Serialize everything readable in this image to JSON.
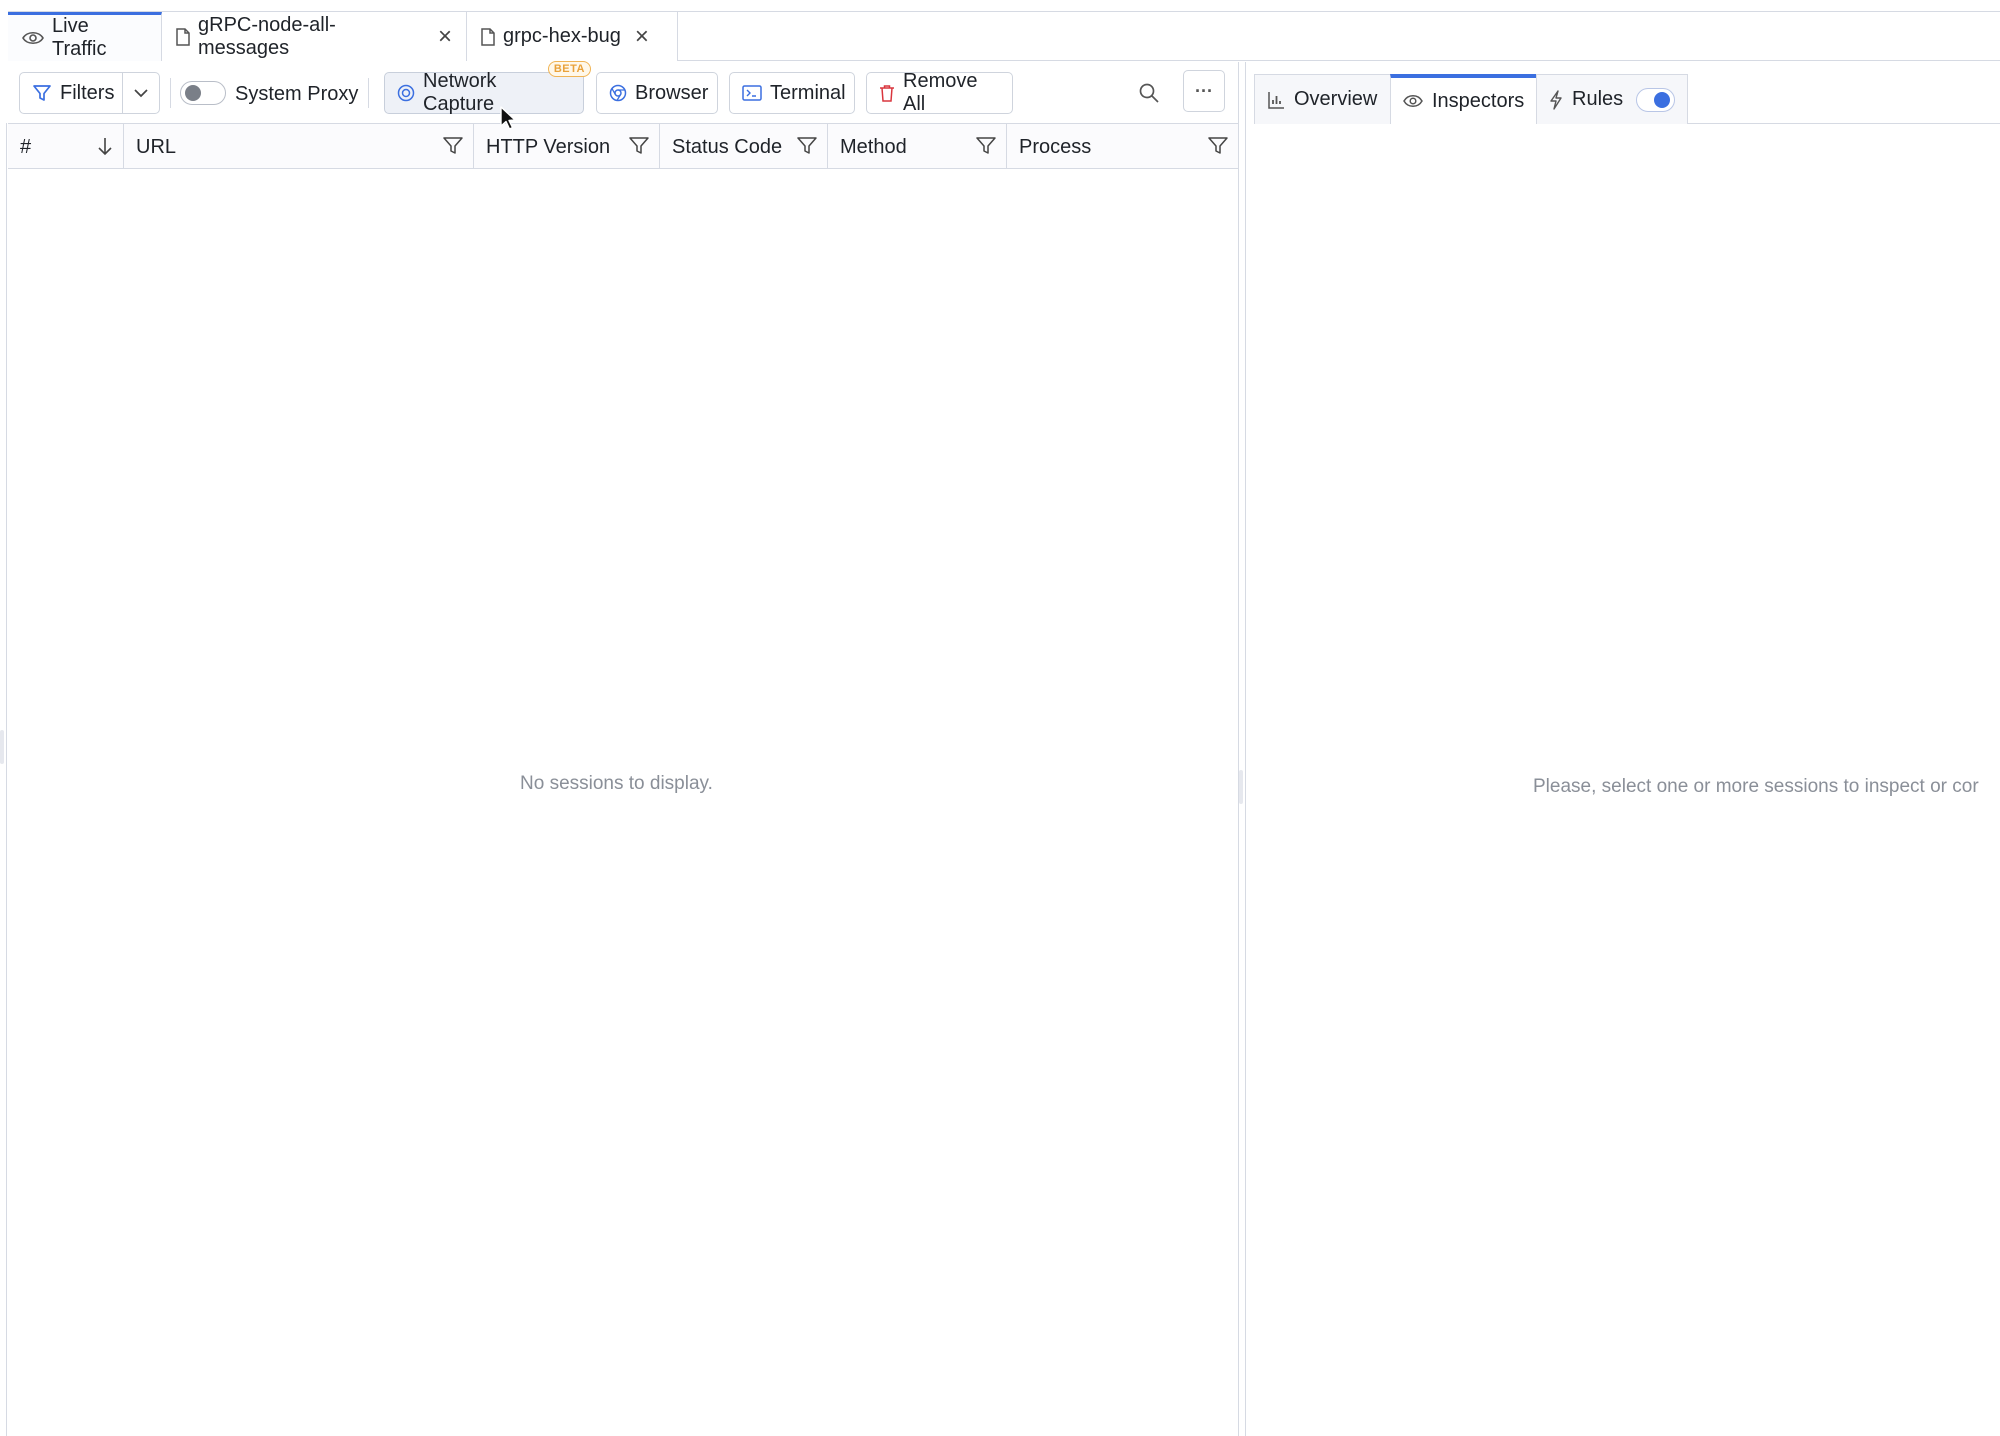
{
  "doc_tabs": [
    {
      "label": "Live Traffic",
      "icon": "eye-icon"
    },
    {
      "label": "gRPC-node-all-messages",
      "icon": "file-icon",
      "close": "×"
    },
    {
      "label": "grpc-hex-bug",
      "icon": "file-icon",
      "close": "×"
    }
  ],
  "toolbar": {
    "filters_label": "Filters",
    "system_proxy_label": "System Proxy",
    "system_proxy_on": false,
    "network_capture_label": "Network Capture",
    "beta_badge": "BETA",
    "browser_label": "Browser",
    "terminal_label": "Terminal",
    "remove_all_label": "Remove All",
    "more_label": "···"
  },
  "grid": {
    "columns": [
      "#",
      "URL",
      "HTTP Version",
      "Status Code",
      "Method",
      "Process"
    ],
    "empty_message": "No sessions to display."
  },
  "right_pane": {
    "tabs": [
      "Overview",
      "Inspectors",
      "Rules"
    ],
    "active_tab": "Inspectors",
    "rules_toggle_on": true,
    "empty_message": "Please, select one or more sessions to inspect or cor"
  },
  "colors": {
    "accent": "#3b6fe0",
    "border": "#d6dae3",
    "remove_icon": "#d9363e",
    "beta": "#e9a23b"
  }
}
